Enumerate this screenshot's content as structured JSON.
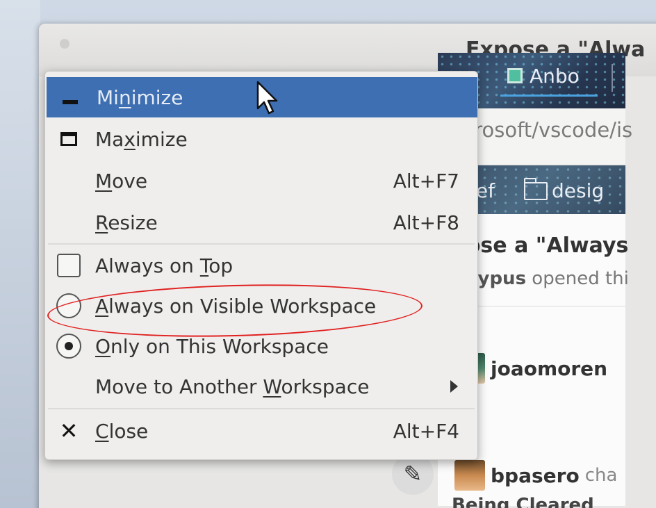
{
  "window": {
    "title": "Expose a \"Alwa"
  },
  "tab": {
    "label": "Anbo",
    "icon": "app-icon"
  },
  "urlbar": {
    "value": "microsoft/vscode/is"
  },
  "bookmarks": [
    {
      "label": "ref",
      "icon": "folder-icon"
    },
    {
      "label": "desig",
      "icon": "folder-icon"
    }
  ],
  "page": {
    "issue_title": "xpose a \"Always",
    "issue_author": "platypus",
    "issue_meta_rest": " opened thi",
    "comments": [
      {
        "user": "joaomoren",
        "rest": ""
      },
      {
        "user": "bpasero",
        "rest": " cha"
      }
    ],
    "cutoff": "Being Cleared"
  },
  "menu": {
    "items": [
      {
        "pre": "Mi",
        "mn": "n",
        "post": "imize",
        "accel": "",
        "icon": "minimize-icon",
        "highlight": true
      },
      {
        "pre": "Ma",
        "mn": "x",
        "post": "imize",
        "accel": "",
        "icon": "maximize-icon"
      },
      {
        "pre": "",
        "mn": "M",
        "post": "ove",
        "accel": "Alt+F7",
        "icon": ""
      },
      {
        "pre": "",
        "mn": "R",
        "post": "esize",
        "accel": "Alt+F8",
        "icon": ""
      },
      {
        "pre": "Always on ",
        "mn": "T",
        "post": "op",
        "accel": "",
        "icon": "checkbox-icon",
        "checked": false
      },
      {
        "pre": "",
        "mn": "A",
        "post": "lways on Visible Workspace",
        "accel": "",
        "icon": "radio-icon",
        "selected": false
      },
      {
        "pre": "",
        "mn": "O",
        "post": "nly on This Workspace",
        "accel": "",
        "icon": "radio-icon",
        "selected": true
      },
      {
        "pre": "Move to Another ",
        "mn": "W",
        "post": "orkspace",
        "accel": "",
        "icon": "submenu-arrow-icon"
      },
      {
        "pre": "",
        "mn": "C",
        "post": "lose",
        "accel": "Alt+F4",
        "icon": "close-icon"
      }
    ]
  },
  "colors": {
    "highlight": "#3d6fb2",
    "annotation": "#e02020"
  }
}
